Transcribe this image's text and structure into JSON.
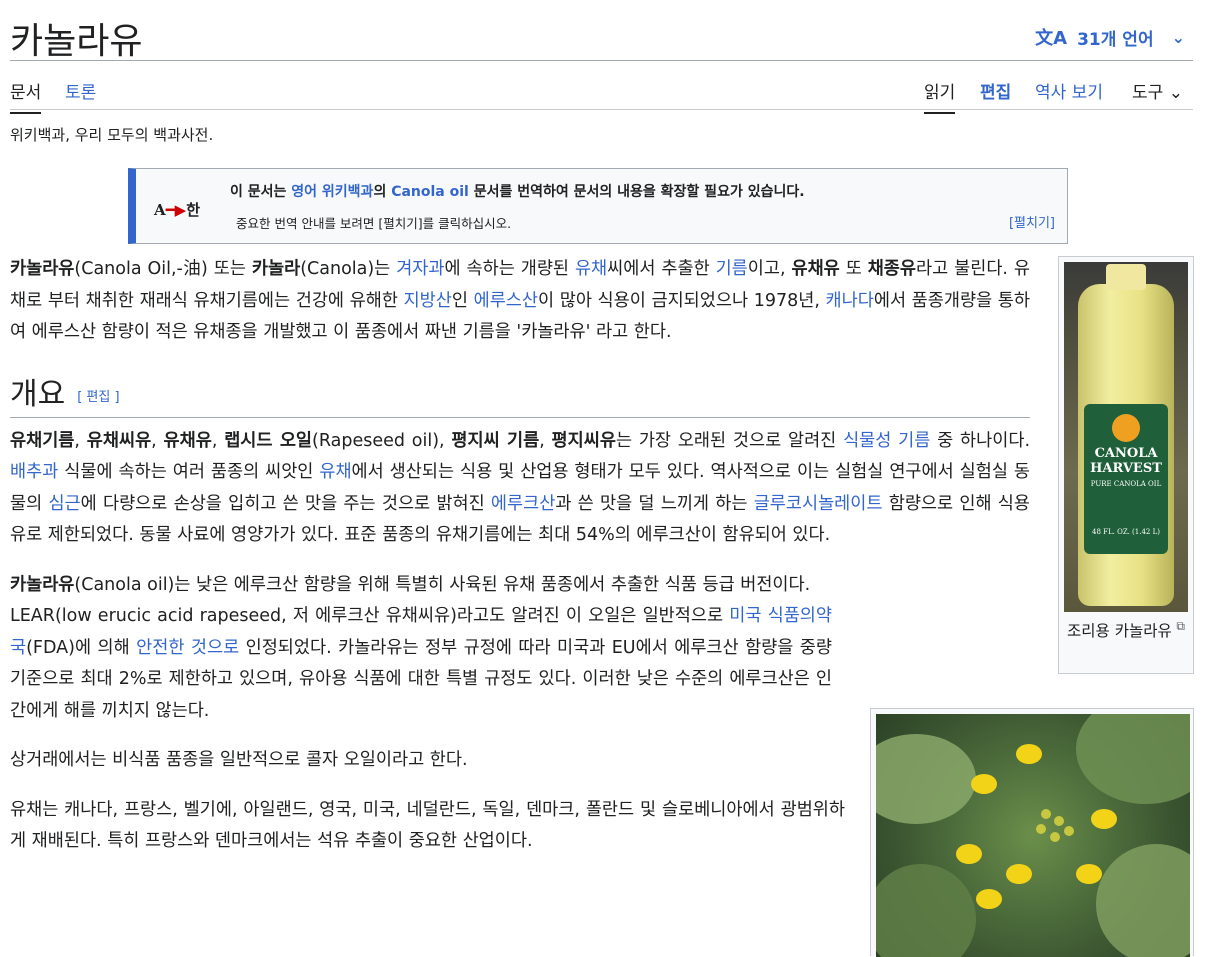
{
  "page": {
    "title": "카놀라유",
    "languages": "31개 언어",
    "tabs": {
      "article": "문서",
      "talk": "토론",
      "read": "읽기",
      "edit": "편집",
      "history": "역사 보기",
      "tools": "도구"
    },
    "tagline": "위키백과, 우리 모두의 백과사전."
  },
  "notice": {
    "art_a": "A",
    "art_han": "한",
    "text_pre": "이 문서는 ",
    "link_wiki": "영어 위키백과",
    "text_mid": "의 ",
    "link_article": "Canola oil",
    "text_post": " 문서를 번역하여 문서의 내용을 확장할 필요가 있습니다.",
    "guide": "중요한 번역 안내를 보려면 [펼치기]를 클릭하십시오.",
    "expand": "[펼치기]"
  },
  "intro": {
    "b1": "카놀라유",
    "t1": "(Canola Oil,-油) 또는 ",
    "b2": "카놀라",
    "t2": "(Canola)는 ",
    "l1": "겨자과",
    "t3": "에 속하는 개량된 ",
    "l2": "유채",
    "t4": "씨에서 추출한 ",
    "l3": "기름",
    "t5": "이고, ",
    "b3": "유채유",
    "t6": " 또 ",
    "b4": "채종유",
    "t7": "라고 불린다. 유채로 부터 채취한 재래식 유채기름에는 건강에 유해한 ",
    "l4": "지방산",
    "t8": "인 ",
    "l5": "에루스산",
    "t9": "이 많아 식용이 금지되었으나 1978년, ",
    "l6": "캐나다",
    "t10": "에서 품종개량을 통하여 에루스산 함량이 적은 유채종을 개발했고 이 품종에서 짜낸 기름을 '카놀라유' 라고 한다."
  },
  "overview": {
    "heading": "개요",
    "edit": "[ 편집 ]",
    "p1": {
      "b1": "유채기름",
      "t1": ", ",
      "b2": "유채씨유",
      "t2": ", ",
      "b3": "유채유",
      "t3": ", ",
      "b4": "랩시드 오일",
      "t4": "(Rapeseed oil), ",
      "b5": "평지씨 기름",
      "t5": ", ",
      "b6": "평지씨유",
      "t6": "는 가장 오래된 것으로 알려진 ",
      "l1": "식물성 기름",
      "t7": " 중 하나이다. ",
      "l2": "배추과",
      "t8": " 식물에 속하는 여러 품종의 씨앗인 ",
      "l3": "유채",
      "t9": "에서 생산되는 식용 및 산업용 형태가 모두 있다. 역사적으로 이는 실험실 연구에서 실험실 동물의 ",
      "l4": "심근",
      "t10": "에 다량으로 손상을 입히고 쓴 맛을 주는 것으로 밝혀진 ",
      "l5": "에루크산",
      "t11": "과 쓴 맛을 덜 느끼게 하는 ",
      "l6": "글루코시놀레이트",
      "t12": " 함량으로 인해 식용유로 제한되었다. 동물 사료에 영양가가 있다. 표준 품종의 유채기름에는 최대 54%의 에루크산이 함유되어 있다."
    },
    "p2": {
      "b1": "카놀라유",
      "t1": "(Canola oil)는 낮은 에루크산 함량을 위해 특별히 사육된 유채 품종에서 추출한 식품 등급 버전이다.",
      "t2": "LEAR(low erucic acid rapeseed, 저 에루크산 유채씨유)라고도 알려진 이 오일은 일반적으로 ",
      "l1": "미국 식품의약국",
      "t3": "(FDA)에 의해 ",
      "l2": "안전한 것으로",
      "t4": " 인정되었다. 카놀라유는 정부 규정에 따라 미국과 EU에서 에루크산 함량을 중량 기준으로 최대 2%로 제한하고 있으며, 유아용 식품에 대한 특별 규정도 있다. 이러한 낮은 수준의 에루크산은 인간에게 해를 끼치지 않는다."
    },
    "p3": "상거래에서는 비식품 품종을 일반적으로 콜자 오일이라고 한다.",
    "p4": "유채는 캐나다, 프랑스, 벨기에, 아일랜드, 영국, 미국, 네덜란드, 독일, 덴마크, 폴란드 및 슬로베니아에서 광범위하게 재배된다. 특히 프랑스와 덴마크에서는 석유 추출이 중요한 산업이다."
  },
  "figure1": {
    "caption": "조리용 카놀라유",
    "label_brand1": "CANOLA",
    "label_brand2": "HARVEST",
    "label_sub": "PURE CANOLA OIL",
    "label_size": "48 FL. OZ. (1.42 L)"
  },
  "colors": {
    "link": "#3366cc",
    "accent": "#36c"
  }
}
